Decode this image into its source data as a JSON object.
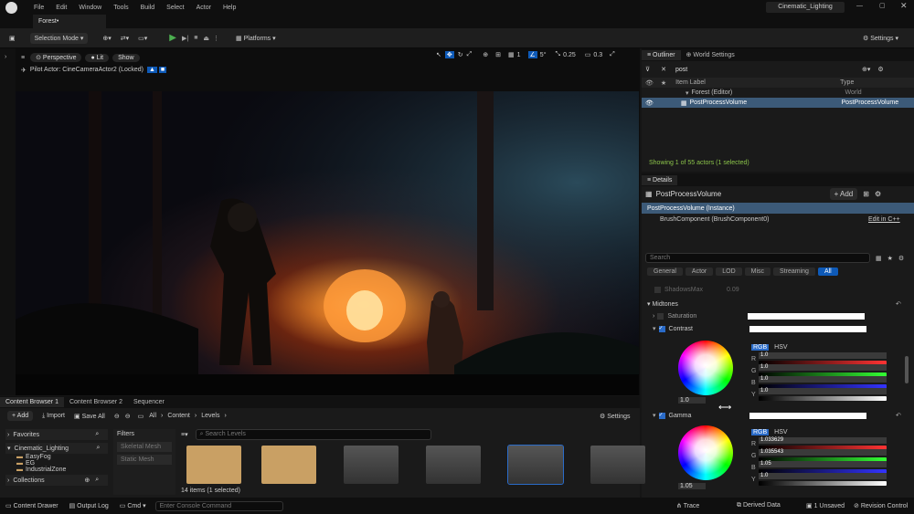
{
  "app": {
    "title": "Cinematic_Lighting",
    "tab": "Forest•"
  },
  "menu": [
    "File",
    "Edit",
    "Window",
    "Tools",
    "Build",
    "Select",
    "Actor",
    "Help"
  ],
  "toolbar": {
    "selection_mode": "Selection Mode",
    "platforms": "Platforms",
    "settings": "Settings"
  },
  "viewport": {
    "perspective": "Perspective",
    "lit": "Lit",
    "show": "Show",
    "pilot": "Pilot Actor: CineCameraActor2 (Locked)",
    "grid": "1",
    "angle": "5°",
    "scale": "0.25",
    "cam_speed": "0.3"
  },
  "outliner": {
    "tabs": [
      "Outliner",
      "World Settings"
    ],
    "search": "post",
    "col_label": "Item Label",
    "col_type": "Type",
    "rows": [
      {
        "label": "Forest (Editor)",
        "type": "World"
      },
      {
        "label": "PostProcessVolume",
        "type": "PostProcessVolume"
      }
    ],
    "status": "Showing 1 of 55 actors (1 selected)"
  },
  "details": {
    "tab": "Details",
    "name": "PostProcessVolume",
    "add": "+ Add",
    "instance": "PostProcessVolume (Instance)",
    "component": "BrushComponent (BrushComponent0)",
    "edit_cpp": "Edit in C++",
    "search_placeholder": "Search",
    "categories": [
      "General",
      "Actor",
      "LOD",
      "Misc",
      "Streaming",
      "All"
    ],
    "shadows_max": "ShadowsMax",
    "shadows_val": "0.09",
    "midtones": "Midtones",
    "saturation": "Saturation",
    "contrast": "Contrast",
    "gamma": "Gamma",
    "rgb": "RGB",
    "hsv": "HSV",
    "contrast_vals": [
      "1.0",
      "1.0",
      "1.0",
      "1.0"
    ],
    "contrast_wheel": "1.0",
    "gamma_vals": [
      "1.033629",
      "1.035543",
      "1.05",
      "1.0"
    ],
    "gamma_wheel": "1.05",
    "channel_letters": [
      "R",
      "G",
      "B",
      "Y"
    ]
  },
  "content_browser": {
    "tabs": [
      "Content Browser 1",
      "Content Browser 2",
      "Sequencer"
    ],
    "add": "+ Add",
    "import": "Import",
    "save_all": "Save All",
    "path": [
      "All",
      "Content",
      "Levels"
    ],
    "settings": "Settings",
    "favorites": "Favorites",
    "project": "Cinematic_Lighting",
    "folders": [
      "EasyFog",
      "EG",
      "IndustrialZone"
    ],
    "collections": "Collections",
    "filters": "Filters",
    "filter_items": [
      "Skeletal Mesh",
      "Static Mesh"
    ],
    "search_placeholder": "Search Levels",
    "item_count": "14 items (1 selected)"
  },
  "statusbar": {
    "content_drawer": "Content Drawer",
    "output_log": "Output Log",
    "cmd": "Cmd",
    "console_placeholder": "Enter Console Command",
    "trace": "Trace",
    "derived_data": "Derived Data",
    "unsaved": "1 Unsaved",
    "revision_control": "Revision Control"
  }
}
